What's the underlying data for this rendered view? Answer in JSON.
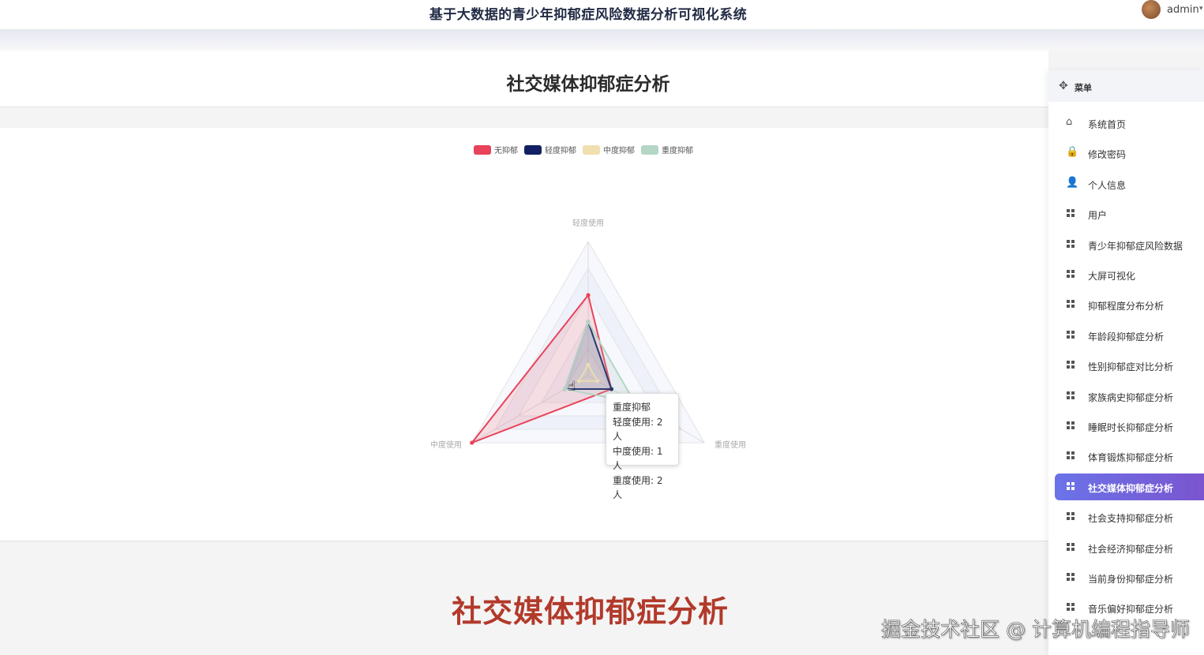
{
  "header": {
    "system_title": "基于大数据的青少年抑郁症风险数据分析可视化系统",
    "user_name": "admin",
    "user_caret": "▾"
  },
  "page": {
    "title": "社交媒体抑郁症分析"
  },
  "chart_data": {
    "type": "radar",
    "title": "",
    "indicators": [
      "轻度使用",
      "重度使用",
      "中度使用"
    ],
    "radius_max": 5,
    "legend_position": "top-center",
    "series": [
      {
        "name": "无抑郁",
        "color": "#e8435a",
        "values": [
          3,
          1,
          5
        ]
      },
      {
        "name": "轻度抑郁",
        "color": "#122063",
        "values": [
          2,
          1,
          1
        ]
      },
      {
        "name": "中度抑郁",
        "color": "#f1dfb0",
        "values": [
          0.4,
          0.4,
          0.4
        ]
      },
      {
        "name": "重度抑郁",
        "color": "#b5d6c5",
        "values": [
          2,
          2,
          1
        ]
      }
    ]
  },
  "tooltip": {
    "title": "重度抑郁",
    "lines": [
      "轻度使用: 2人",
      "中度使用: 1人",
      "重度使用: 2人"
    ]
  },
  "sidebar": {
    "header": {
      "label": "菜单",
      "icon": "move-icon"
    },
    "active_index": 12,
    "items": [
      {
        "label": "系统首页",
        "icon": "home-icon"
      },
      {
        "label": "修改密码",
        "icon": "lock-icon"
      },
      {
        "label": "个人信息",
        "icon": "user-icon"
      },
      {
        "label": "用户",
        "icon": "grid-icon"
      },
      {
        "label": "青少年抑郁症风险数据",
        "icon": "grid-icon"
      },
      {
        "label": "大屏可视化",
        "icon": "grid-icon"
      },
      {
        "label": "抑郁程度分布分析",
        "icon": "grid-icon"
      },
      {
        "label": "年龄段抑郁症分析",
        "icon": "grid-icon"
      },
      {
        "label": "性别抑郁症对比分析",
        "icon": "grid-icon"
      },
      {
        "label": "家族病史抑郁症分析",
        "icon": "grid-icon"
      },
      {
        "label": "睡眠时长抑郁症分析",
        "icon": "grid-icon"
      },
      {
        "label": "体育锻炼抑郁症分析",
        "icon": "grid-icon"
      },
      {
        "label": "社交媒体抑郁症分析",
        "icon": "grid-icon"
      },
      {
        "label": "社会支持抑郁症分析",
        "icon": "grid-icon"
      },
      {
        "label": "社会经济抑郁症分析",
        "icon": "grid-icon"
      },
      {
        "label": "当前身份抑郁症分析",
        "icon": "grid-icon"
      },
      {
        "label": "音乐偏好抑郁症分析",
        "icon": "grid-icon"
      }
    ]
  },
  "caption": {
    "text": "社交媒体抑郁症分析"
  },
  "watermark": {
    "text": "掘金技术社区 @ 计算机编程指导师"
  }
}
